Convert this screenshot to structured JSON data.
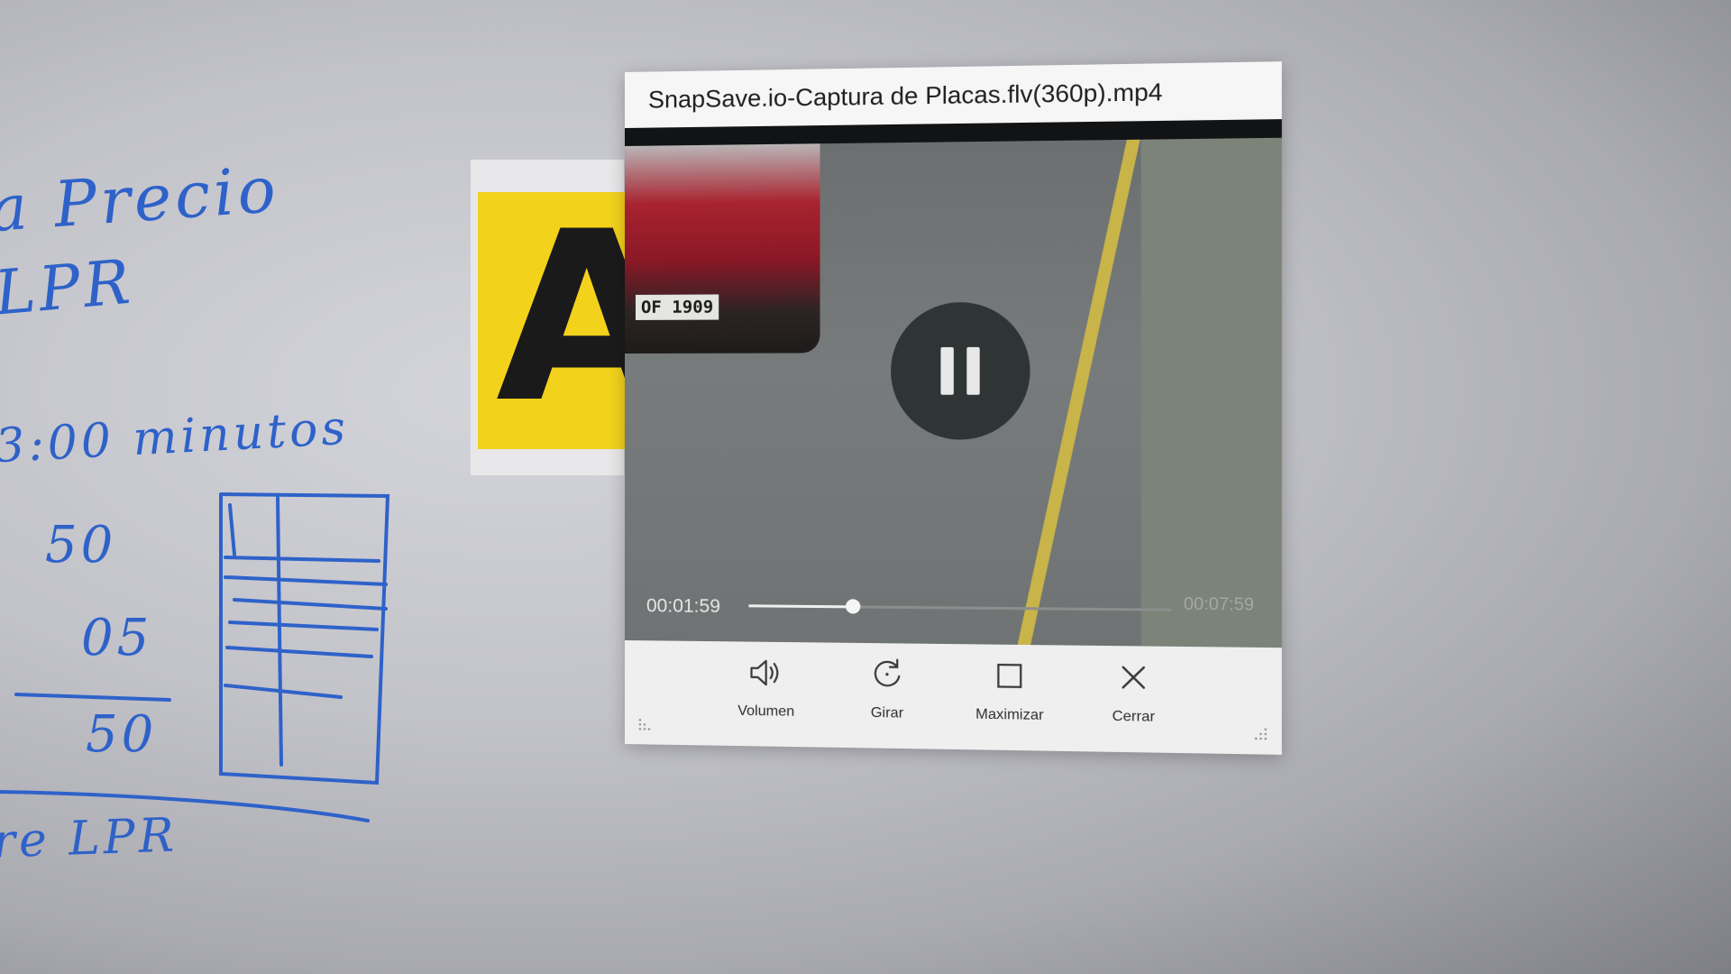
{
  "board": {
    "lines": [
      {
        "text": "a  Precio"
      },
      {
        "text": "LPR"
      },
      {
        "text": "3:00 minutos"
      },
      {
        "text": "50"
      },
      {
        "text": "05"
      },
      {
        "text": "50"
      },
      {
        "text": "re  LPR"
      }
    ]
  },
  "plate_graphic": {
    "text": "AZ",
    "color": "#f3d21c"
  },
  "player": {
    "title": "SnapSave.io-Captura de Placas.flv(360p).mp4",
    "video": {
      "car_plate": "OF 1909",
      "state": "playing",
      "pause_icon": "pause-icon"
    },
    "time_current": "00:01:59",
    "time_total": "00:07:59",
    "progress": 0.25,
    "controls": [
      {
        "label": "Volumen",
        "icon": "speaker-icon"
      },
      {
        "label": "Girar",
        "icon": "rotate-icon"
      },
      {
        "label": "Maximizar",
        "icon": "maximize-icon"
      },
      {
        "label": "Cerrar",
        "icon": "close-icon"
      }
    ]
  }
}
